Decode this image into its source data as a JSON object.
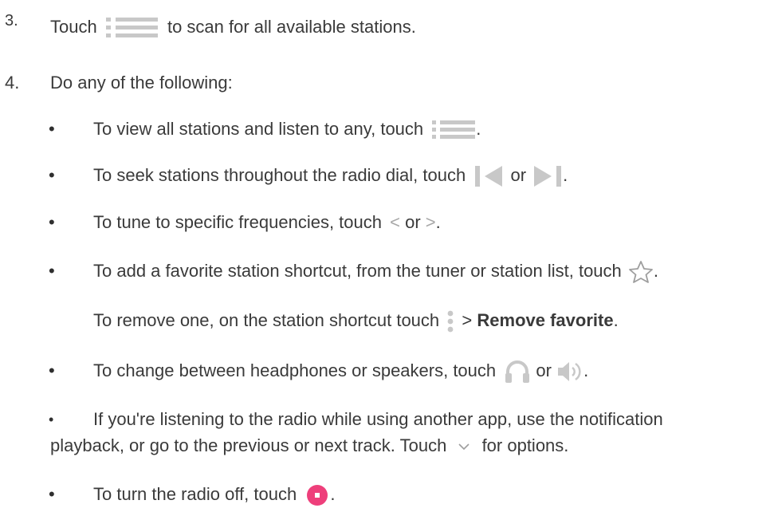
{
  "steps": [
    {
      "number": "3.",
      "text_before": "Touch",
      "icon": "station-list-icon",
      "text_after": "to scan for all available stations."
    },
    {
      "number": "4.",
      "text": "Do any of the following:"
    }
  ],
  "bullets": [
    {
      "before": "To view all stations and listen to any, touch",
      "icon": "station-list-icon",
      "after": "."
    },
    {
      "before": "To seek stations throughout the radio dial, touch",
      "icon_a": "seek-back-icon",
      "joiner": "or",
      "icon_b": "seek-forward-icon",
      "after": "."
    },
    {
      "before": "To tune to specific frequencies, touch",
      "icon_a": "chevron-left-icon",
      "glyph_a": "<",
      "joiner": "or",
      "icon_b": "chevron-right-icon",
      "glyph_b": ">",
      "after": "."
    },
    {
      "before": "To add a favorite station shortcut, from the tuner or station list, touch",
      "icon": "star-outline-icon",
      "after": "."
    },
    {
      "before": "To remove one, on the station shortcut touch",
      "icon": "more-vert-icon",
      "gt": ">",
      "bold": "Remove favorite",
      "after": "."
    },
    {
      "before": "To change between headphones or speakers, touch",
      "icon_a": "headphones-icon",
      "joiner": "or",
      "icon_b": "speaker-icon",
      "after": "."
    },
    {
      "line1": "If you're listening to the radio while using another app, use the notification",
      "line2_before": "playback, or go to the previous or next track. Touch",
      "icon": "chevron-down-icon",
      "line2_after": "for options."
    },
    {
      "before": "To turn the radio off, touch",
      "icon": "power-off-button-icon",
      "after": "."
    }
  ],
  "colors": {
    "text": "#3a3a3a",
    "icon_gray": "#c8c8c8",
    "icon_dark_gray": "#9e9e9e",
    "power_pink": "#ee3f7b"
  }
}
